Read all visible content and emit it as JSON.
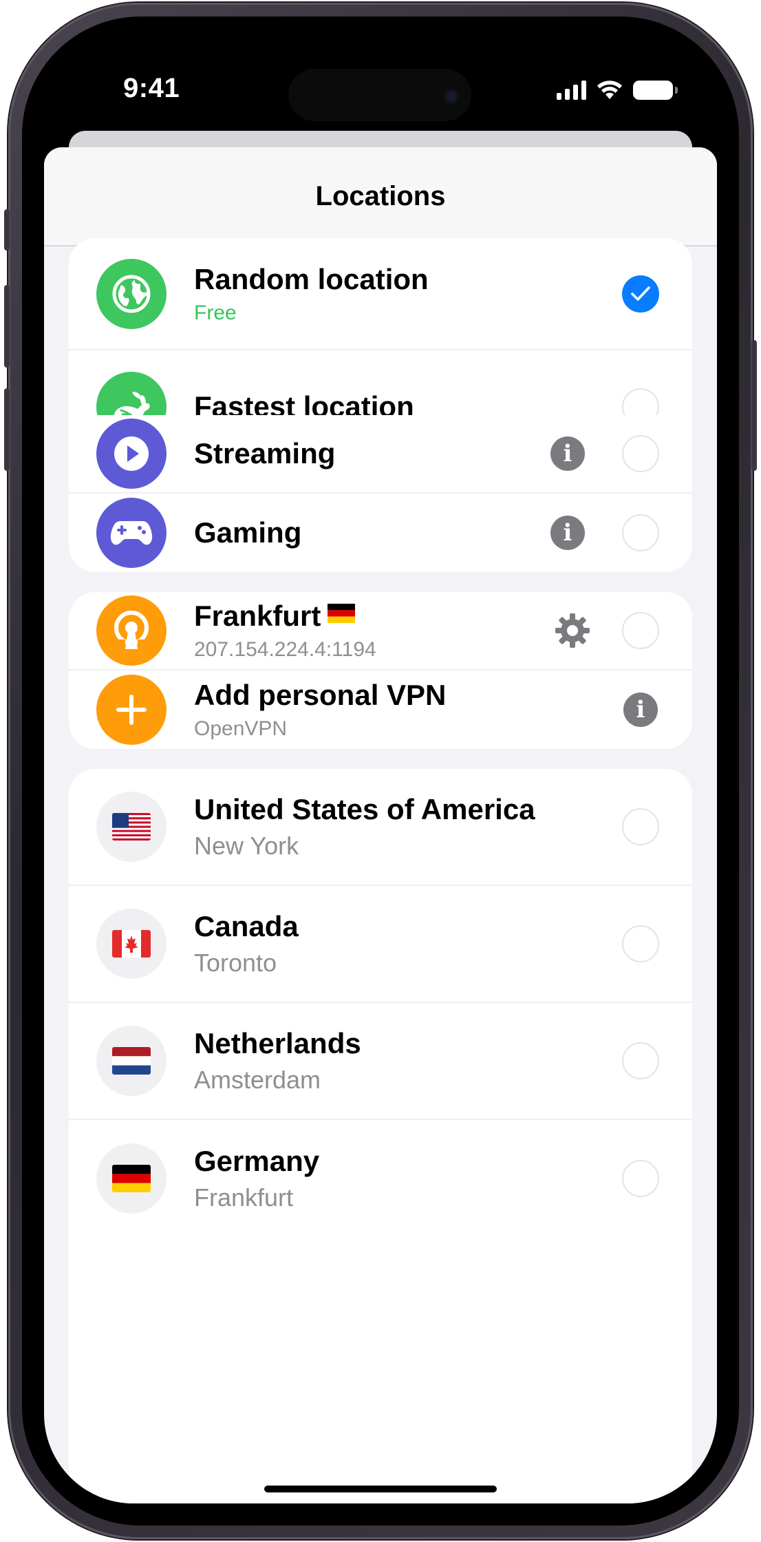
{
  "status_bar": {
    "time": "9:41"
  },
  "sheet": {
    "title": "Locations"
  },
  "groups": {
    "smart": [
      {
        "id": "random",
        "title": "Random location",
        "subtitle": "Free",
        "icon": "globe-icon",
        "selected": true
      },
      {
        "id": "fastest",
        "title": "Fastest location",
        "subtitle": "",
        "icon": "rabbit-icon",
        "selected": false
      }
    ],
    "special": [
      {
        "id": "streaming",
        "title": "Streaming",
        "icon": "play-icon",
        "selected": false
      },
      {
        "id": "gaming",
        "title": "Gaming",
        "icon": "gamepad-icon",
        "selected": false
      }
    ],
    "personal": [
      {
        "id": "frankfurt-vpn",
        "title": "Frankfurt",
        "subtitle": "207.154.224.4:1194",
        "icon": "openvpn-icon",
        "flag": "de",
        "selected": false
      },
      {
        "id": "add-vpn",
        "title": "Add personal VPN",
        "subtitle": "OpenVPN",
        "icon": "plus-icon"
      }
    ],
    "countries": [
      {
        "id": "usa",
        "title": "United States of America",
        "subtitle": "New York",
        "flag": "us",
        "selected": false
      },
      {
        "id": "canada",
        "title": "Canada",
        "subtitle": "Toronto",
        "flag": "ca",
        "selected": false
      },
      {
        "id": "netherlands",
        "title": "Netherlands",
        "subtitle": "Amsterdam",
        "flag": "nl",
        "selected": false
      },
      {
        "id": "germany",
        "title": "Germany",
        "subtitle": "Frankfurt",
        "flag": "de",
        "selected": false
      }
    ]
  },
  "colors": {
    "accent_blue": "#0a7cff",
    "green": "#3ec65f",
    "purple": "#5e5ad6",
    "orange": "#ff9c0a",
    "free_text": "#34c759"
  }
}
